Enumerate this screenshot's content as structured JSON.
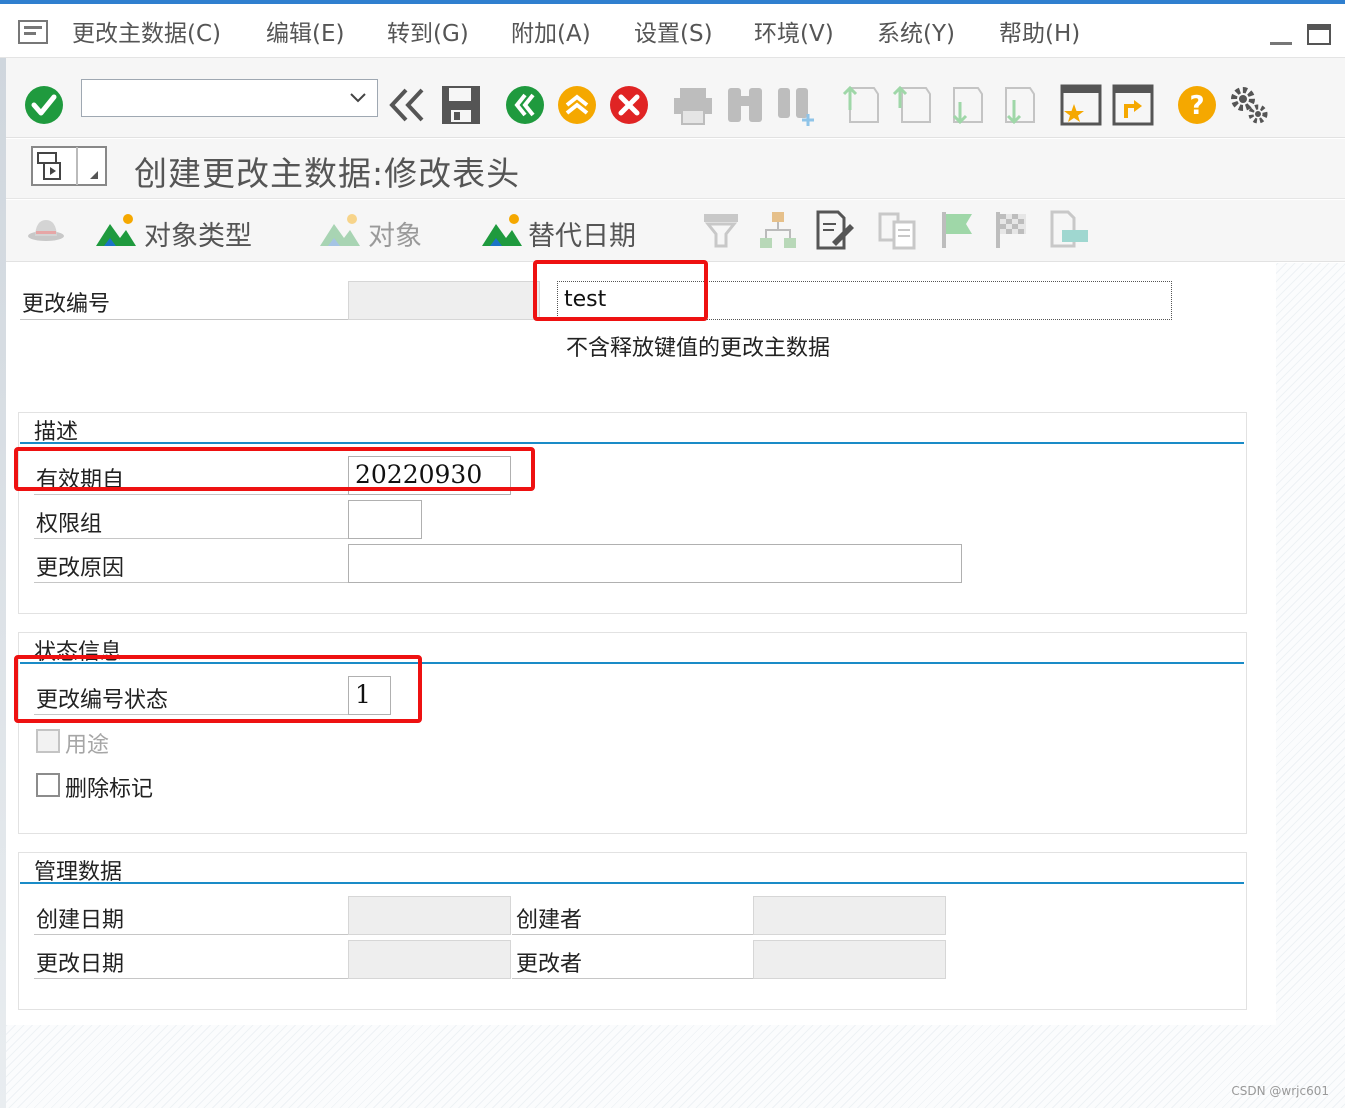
{
  "menu": {
    "items": [
      "更改主数据(C)",
      "编辑(E)",
      "转到(G)",
      "附加(A)",
      "设置(S)",
      "环境(V)",
      "系统(Y)",
      "帮助(H)"
    ]
  },
  "toolbar": {
    "command_value": ""
  },
  "title": {
    "text": "创建更改主数据:修改表头"
  },
  "app_toolbar": {
    "object_type": "对象类型",
    "object": "对象",
    "alt_date": "替代日期"
  },
  "header": {
    "change_number_label": "更改编号",
    "change_number_value": "test",
    "description_text": "不含释放键值的更改主数据"
  },
  "description_group": {
    "title": "描述",
    "valid_from_label": "有效期自",
    "valid_from_value": "20220930",
    "auth_group_label": "权限组",
    "auth_group_value": "",
    "reason_label": "更改原因",
    "reason_value": ""
  },
  "status_group": {
    "title": "状态信息",
    "status_label": "更改编号状态",
    "status_value": "1",
    "usage_label": "用途",
    "delete_flag_label": "删除标记"
  },
  "admin_group": {
    "title": "管理数据",
    "created_on_label": "创建日期",
    "created_by_label": "创建者",
    "changed_on_label": "更改日期",
    "changed_by_label": "更改者"
  },
  "colors": {
    "accent_blue": "#1a8bc7",
    "ok_green": "#1f9a3e",
    "cancel_red": "#e02424",
    "help_orange": "#f5a800",
    "highlight_red": "#ee1111"
  },
  "watermark": "CSDN @wrjc601"
}
